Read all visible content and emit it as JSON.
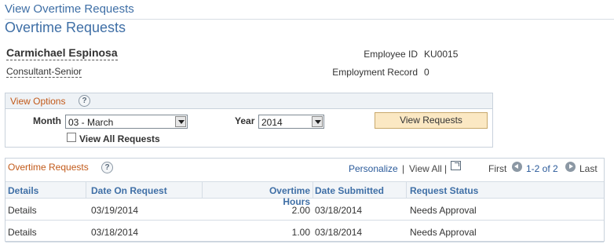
{
  "breadcrumb": "View Overtime Requests",
  "page_title": "Overtime Requests",
  "employee": {
    "name": "Carmichael Espinosa",
    "title": "Consultant-Senior",
    "id_label": "Employee ID",
    "id_value": "KU0015",
    "record_label": "Employment Record",
    "record_value": "0"
  },
  "view_options": {
    "title": "View Options",
    "help_glyph": "?",
    "month_label": "Month",
    "month_value": "03 - March",
    "year_label": "Year",
    "year_value": "2014",
    "view_all_label": "View All Requests",
    "view_all_checked": false,
    "view_requests_button": "View Requests"
  },
  "grid": {
    "title": "Overtime Requests",
    "help_glyph": "?",
    "personalize": "Personalize",
    "separator": "|",
    "view_all": "View All",
    "first": "First",
    "range": "1-2 of 2",
    "last": "Last",
    "columns": [
      "Details",
      "Date On Request",
      "Overtime Hours",
      "Date Submitted",
      "Request Status"
    ],
    "rows": [
      {
        "details": "Details",
        "date_on_request": "03/19/2014",
        "overtime_hours": "2.00",
        "date_submitted": "03/18/2014",
        "status": "Needs Approval"
      },
      {
        "details": "Details",
        "date_on_request": "03/18/2014",
        "overtime_hours": "1.00",
        "date_submitted": "03/18/2014",
        "status": "Needs Approval"
      }
    ]
  },
  "colors": {
    "link_blue": "#3f6fa6",
    "section_orange": "#c25a1a",
    "button_fill": "#fbe8c3"
  },
  "icons": {
    "help": "help-icon",
    "dropdown": "chevron-down-icon",
    "zoom": "zoom-grid-icon",
    "prev": "previous-arrow-icon",
    "next": "next-arrow-icon"
  }
}
